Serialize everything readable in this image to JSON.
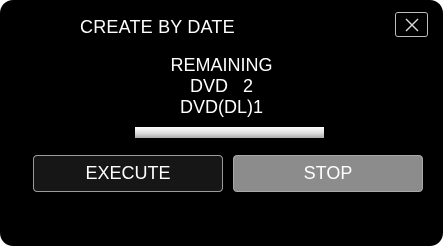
{
  "dialog": {
    "title": "CREATE BY DATE",
    "close_icon": "close-x-icon"
  },
  "status": {
    "line1": "REMAINING",
    "line2": "DVD   2",
    "line3": "DVD(DL)1"
  },
  "progress": {
    "fraction": 1.0
  },
  "buttons": {
    "execute_label": "EXECUTE",
    "stop_label": "STOP"
  },
  "colors": {
    "background": "#000000",
    "text": "#ffffff",
    "stop_button": "#8c8c8c"
  }
}
